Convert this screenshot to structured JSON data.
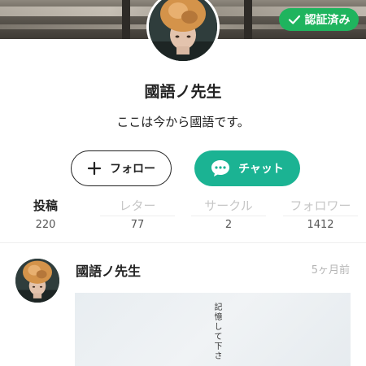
{
  "profile": {
    "verified_label": "認証済み",
    "name": "國語ノ先生",
    "bio": "ここは今から國語です。"
  },
  "actions": {
    "follow_label": "フォロー",
    "chat_label": "チャット"
  },
  "stats": [
    {
      "label": "投稿",
      "count": "220"
    },
    {
      "label": "レター",
      "count": "77"
    },
    {
      "label": "サークル",
      "count": "2"
    },
    {
      "label": "フォロワー",
      "count": "1412"
    }
  ],
  "post": {
    "author": "國語ノ先生",
    "time": "5ヶ月前",
    "image_text": "記憶して下さ"
  },
  "colors": {
    "verified_green": "#1fb45e",
    "chat_teal": "#1bb393",
    "muted_gray": "#c6c6c6"
  }
}
